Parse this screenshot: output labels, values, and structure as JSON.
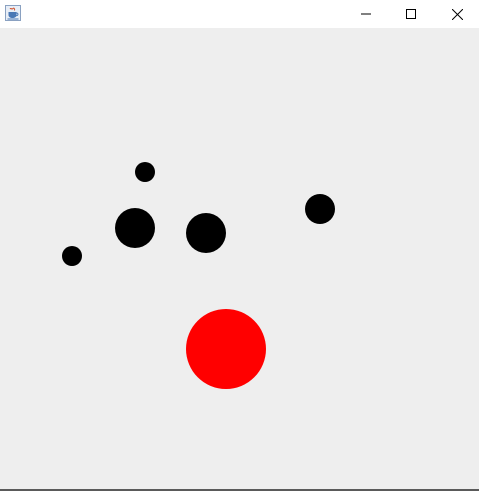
{
  "window": {
    "title": "",
    "app_icon": "java-cup-icon",
    "controls": {
      "minimize_icon": "minimize-icon",
      "maximize_icon": "maximize-icon",
      "close_icon": "close-icon"
    }
  },
  "canvas": {
    "background": "#eeeeee",
    "balls": [
      {
        "name": "black-ball-small-1",
        "color": "#000000"
      },
      {
        "name": "black-ball-large-1",
        "color": "#000000"
      },
      {
        "name": "black-ball-large-2",
        "color": "#000000"
      },
      {
        "name": "black-ball-medium-1",
        "color": "#000000"
      },
      {
        "name": "black-ball-small-2",
        "color": "#000000"
      },
      {
        "name": "red-ball",
        "color": "#ff0000"
      }
    ]
  }
}
